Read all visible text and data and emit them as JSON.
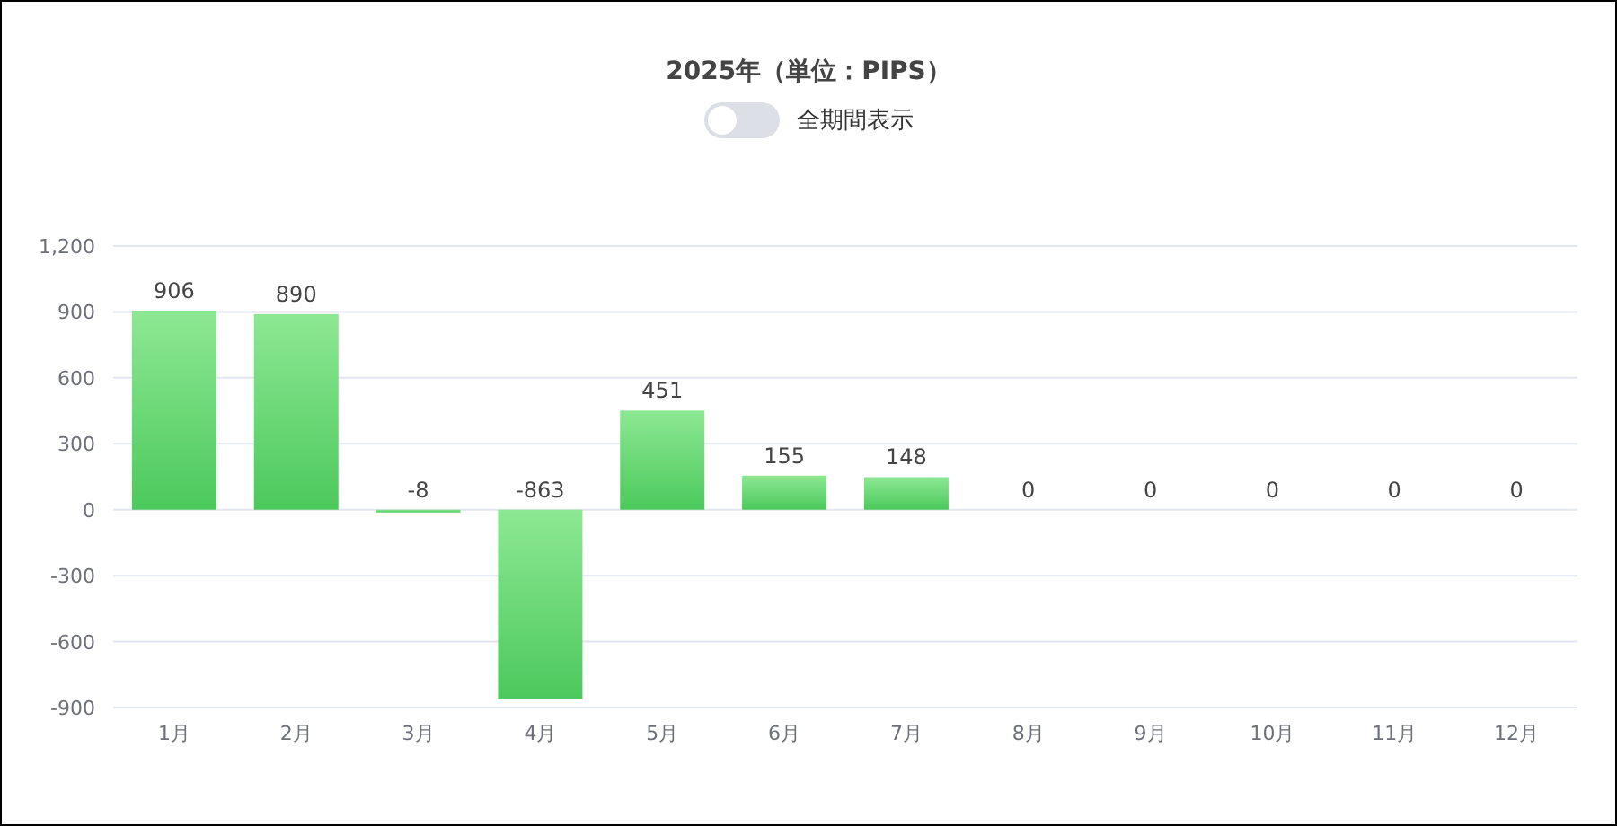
{
  "chart": {
    "title": "2025年（単位：PIPS）",
    "toggle": {
      "label": "全期間表示",
      "on": false
    },
    "chart_data": {
      "type": "bar",
      "categories": [
        "1月",
        "2月",
        "3月",
        "4月",
        "5月",
        "6月",
        "7月",
        "8月",
        "9月",
        "10月",
        "11月",
        "12月"
      ],
      "series": [
        {
          "color": "#4cc95c",
          "values": [
            906,
            890,
            -8,
            -863,
            451,
            155,
            148,
            0,
            0,
            0,
            0,
            0
          ]
        }
      ],
      "ylim": [
        -900,
        1200
      ],
      "yticks": [
        {
          "value": -900,
          "label": "-900"
        },
        {
          "value": -600,
          "label": "-600"
        },
        {
          "value": -300,
          "label": "-300"
        },
        {
          "value": 0,
          "label": "0"
        },
        {
          "value": 300,
          "label": "300"
        },
        {
          "value": 600,
          "label": "600"
        },
        {
          "value": 900,
          "label": "900"
        },
        {
          "value": 1200,
          "label": "1,200"
        }
      ],
      "grid": true,
      "data_labels": true
    }
  }
}
